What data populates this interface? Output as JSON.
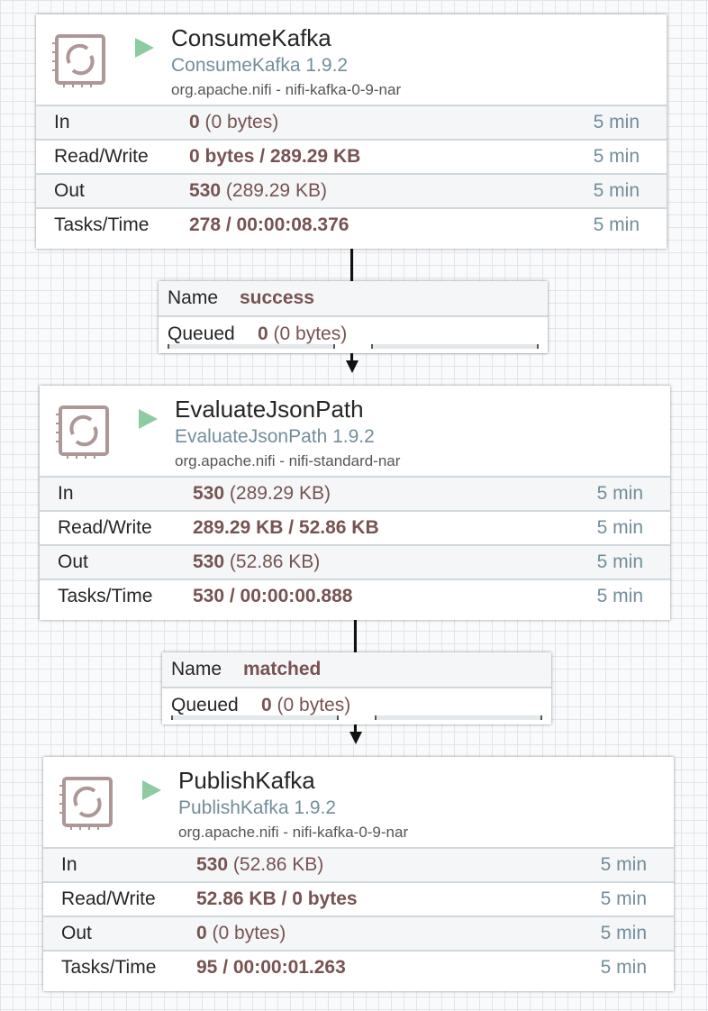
{
  "processors": [
    {
      "name": "ConsumeKafka",
      "type": "ConsumeKafka 1.9.2",
      "bundle": "org.apache.nifi - nifi-kafka-0-9-nar",
      "stats": {
        "in_label": "In",
        "in_count": "0",
        "in_size": "(0 bytes)",
        "in_time": "5 min",
        "rw_label": "Read/Write",
        "rw_value": "0 bytes / 289.29 KB",
        "rw_time": "5 min",
        "out_label": "Out",
        "out_count": "530",
        "out_size": "(289.29 KB)",
        "out_time": "5 min",
        "tasks_label": "Tasks/Time",
        "tasks_value": "278 / 00:00:08.376",
        "tasks_time": "5 min"
      }
    },
    {
      "name": "EvaluateJsonPath",
      "type": "EvaluateJsonPath 1.9.2",
      "bundle": "org.apache.nifi - nifi-standard-nar",
      "stats": {
        "in_label": "In",
        "in_count": "530",
        "in_size": "(289.29 KB)",
        "in_time": "5 min",
        "rw_label": "Read/Write",
        "rw_value": "289.29 KB / 52.86 KB",
        "rw_time": "5 min",
        "out_label": "Out",
        "out_count": "530",
        "out_size": "(52.86 KB)",
        "out_time": "5 min",
        "tasks_label": "Tasks/Time",
        "tasks_value": "530 / 00:00:00.888",
        "tasks_time": "5 min"
      }
    },
    {
      "name": "PublishKafka",
      "type": "PublishKafka 1.9.2",
      "bundle": "org.apache.nifi - nifi-kafka-0-9-nar",
      "stats": {
        "in_label": "In",
        "in_count": "530",
        "in_size": "(52.86 KB)",
        "in_time": "5 min",
        "rw_label": "Read/Write",
        "rw_value": "52.86 KB / 0 bytes",
        "rw_time": "5 min",
        "out_label": "Out",
        "out_count": "0",
        "out_size": "(0 bytes)",
        "out_time": "5 min",
        "tasks_label": "Tasks/Time",
        "tasks_value": "95 / 00:00:01.263",
        "tasks_time": "5 min"
      }
    }
  ],
  "connections": [
    {
      "name_label": "Name",
      "name": "success",
      "queued_label": "Queued",
      "queued_count": "0",
      "queued_size": "(0 bytes)"
    },
    {
      "name_label": "Name",
      "name": "matched",
      "queued_label": "Queued",
      "queued_count": "0",
      "queued_size": "(0 bytes)"
    }
  ],
  "colors": {
    "run_icon": "#8dcca1",
    "value_text": "#775351",
    "type_text": "#728e9b",
    "icon_stroke": "#ad9897"
  },
  "icons": {
    "processor": "processor-icon",
    "run": "run-status-icon"
  }
}
